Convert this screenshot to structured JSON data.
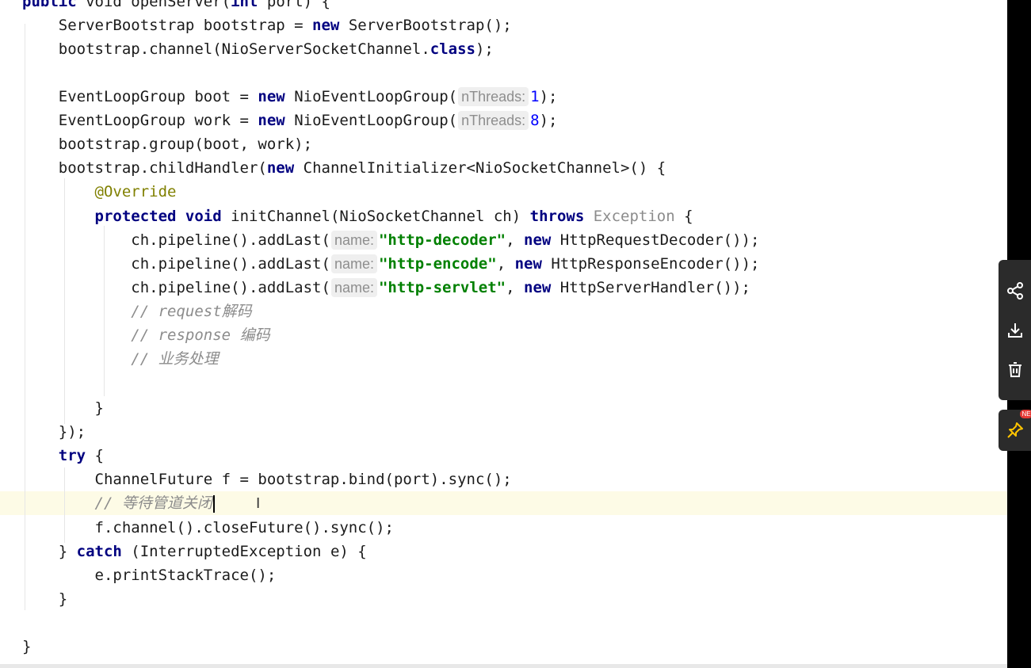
{
  "editor": {
    "lines": [
      [
        {
          "t": "public",
          "c": "kw"
        },
        {
          "t": " void openServer("
        },
        {
          "t": "int",
          "c": "kw"
        },
        {
          "t": " port) {"
        }
      ],
      [
        {
          "t": "    ServerBootstrap bootstrap = "
        },
        {
          "t": "new",
          "c": "kw"
        },
        {
          "t": " ServerBootstrap();"
        }
      ],
      [
        {
          "t": "    bootstrap.channel(NioServerSocketChannel."
        },
        {
          "t": "class",
          "c": "kw"
        },
        {
          "t": ");"
        }
      ],
      [],
      [
        {
          "t": "    EventLoopGroup boot = "
        },
        {
          "t": "new",
          "c": "kw"
        },
        {
          "t": " NioEventLoopGroup("
        },
        {
          "t": "nThreads:",
          "c": "hint"
        },
        {
          "t": "1",
          "c": "num"
        },
        {
          "t": ");"
        }
      ],
      [
        {
          "t": "    EventLoopGroup work = "
        },
        {
          "t": "new",
          "c": "kw"
        },
        {
          "t": " NioEventLoopGroup("
        },
        {
          "t": "nThreads:",
          "c": "hint"
        },
        {
          "t": "8",
          "c": "num"
        },
        {
          "t": ");"
        }
      ],
      [
        {
          "t": "    bootstrap.group(boot, work);"
        }
      ],
      [
        {
          "t": "    bootstrap.childHandler("
        },
        {
          "t": "new",
          "c": "kw"
        },
        {
          "t": " ChannelInitializer<NioSocketChannel>() {"
        }
      ],
      [
        {
          "t": "        "
        },
        {
          "t": "@Override",
          "c": "ann"
        }
      ],
      [
        {
          "t": "        "
        },
        {
          "t": "protected",
          "c": "kw"
        },
        {
          "t": " "
        },
        {
          "t": "void",
          "c": "kw"
        },
        {
          "t": " initChannel(NioSocketChannel ch) "
        },
        {
          "t": "throws",
          "c": "kw"
        },
        {
          "t": " "
        },
        {
          "t": "Exception",
          "c": "exc"
        },
        {
          "t": " {"
        }
      ],
      [
        {
          "t": "            ch.pipeline().addLast("
        },
        {
          "t": "name:",
          "c": "hint"
        },
        {
          "t": "\"http-decoder\"",
          "c": "str"
        },
        {
          "t": ", "
        },
        {
          "t": "new",
          "c": "kw"
        },
        {
          "t": " HttpRequestDecoder());"
        }
      ],
      [
        {
          "t": "            ch.pipeline().addLast("
        },
        {
          "t": "name:",
          "c": "hint"
        },
        {
          "t": "\"http-encode\"",
          "c": "str"
        },
        {
          "t": ", "
        },
        {
          "t": "new",
          "c": "kw"
        },
        {
          "t": " HttpResponseEncoder());"
        }
      ],
      [
        {
          "t": "            ch.pipeline().addLast("
        },
        {
          "t": "name:",
          "c": "hint"
        },
        {
          "t": "\"http-servlet\"",
          "c": "str"
        },
        {
          "t": ", "
        },
        {
          "t": "new",
          "c": "kw"
        },
        {
          "t": " HttpServerHandler());"
        }
      ],
      [
        {
          "t": "            "
        },
        {
          "t": "// request",
          "c": "cmt"
        },
        {
          "t": "解码",
          "c": "cmt cmt-cjk"
        }
      ],
      [
        {
          "t": "            "
        },
        {
          "t": "// response ",
          "c": "cmt"
        },
        {
          "t": "编码",
          "c": "cmt cmt-cjk"
        }
      ],
      [
        {
          "t": "            "
        },
        {
          "t": "// ",
          "c": "cmt"
        },
        {
          "t": "业务处理",
          "c": "cmt cmt-cjk"
        }
      ],
      [],
      [
        {
          "t": "        }"
        }
      ],
      [
        {
          "t": "    });"
        }
      ],
      [
        {
          "t": "    "
        },
        {
          "t": "try",
          "c": "kw"
        },
        {
          "t": " {"
        }
      ],
      [
        {
          "t": "        ChannelFuture f = bootstrap.bind(port).sync();"
        }
      ],
      [
        {
          "t": "        "
        },
        {
          "t": "// ",
          "c": "cmt"
        },
        {
          "t": "等待管道关闭",
          "c": "cmt cmt-cjk"
        },
        {
          "t": "",
          "c": "caret"
        }
      ],
      [
        {
          "t": "        f.channel().closeFuture().sync();"
        }
      ],
      [
        {
          "t": "    } "
        },
        {
          "t": "catch",
          "c": "kw"
        },
        {
          "t": " (InterruptedException e) {"
        }
      ],
      [
        {
          "t": "        e.printStackTrace();"
        }
      ],
      [
        {
          "t": "    }"
        }
      ],
      [],
      [
        {
          "t": "}"
        }
      ]
    ]
  },
  "floating_toolbar": {
    "items": [
      {
        "name": "share-icon"
      },
      {
        "name": "download-icon"
      },
      {
        "name": "delete-icon"
      }
    ],
    "pin": {
      "name": "pin-icon",
      "badge": "NE"
    }
  },
  "colors": {
    "keyword": "#000080",
    "string": "#008000",
    "number": "#0000ff",
    "annotation": "#808000",
    "comment": "#8c8c8c",
    "current_line": "#fdfbe6"
  }
}
